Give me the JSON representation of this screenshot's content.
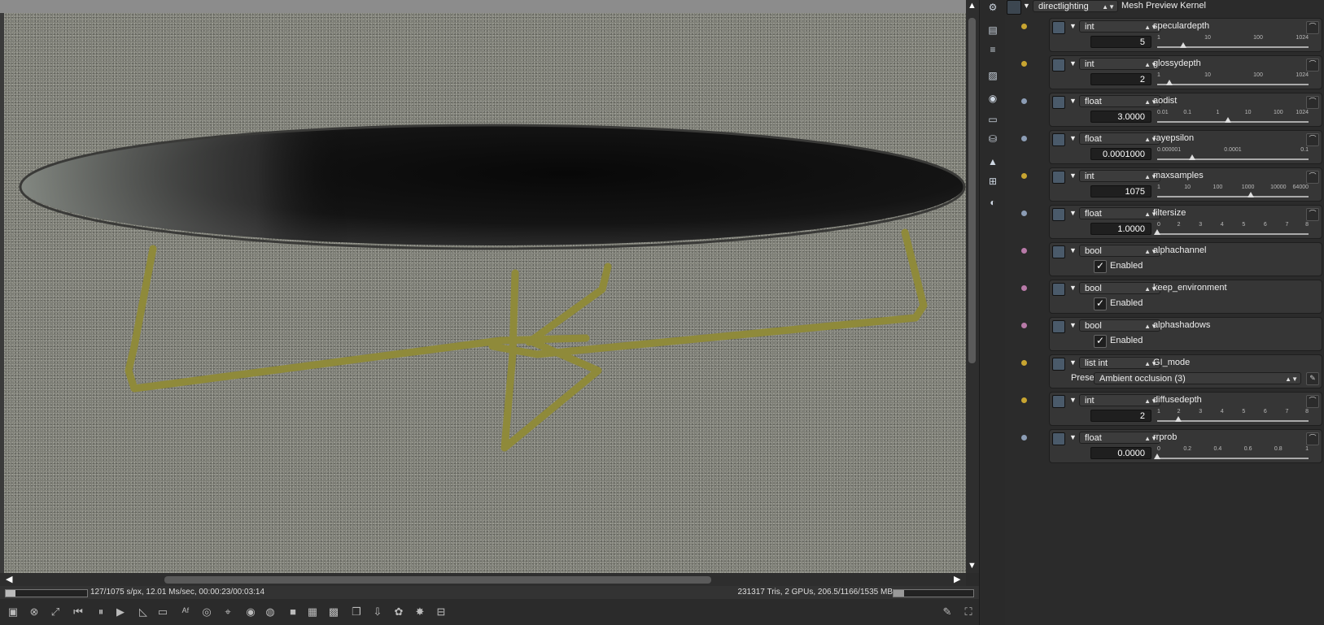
{
  "header": {
    "kernel_select": "directlighting",
    "title": "Mesh Preview Kernel"
  },
  "params": [
    {
      "name": "speculardepth",
      "type": "int",
      "kind": "slider",
      "icon": "int-icon",
      "dot": "#c8a531",
      "value": "5",
      "ticks": [
        "1",
        "10",
        "100",
        "1024"
      ],
      "thumb": 0.17
    },
    {
      "name": "glossydepth",
      "type": "int",
      "kind": "slider",
      "icon": "int-icon",
      "dot": "#c8a531",
      "value": "2",
      "ticks": [
        "1",
        "10",
        "100",
        "1024"
      ],
      "thumb": 0.08
    },
    {
      "name": "aodist",
      "type": "float",
      "kind": "slider",
      "icon": "float-icon",
      "dot": "#8c9db5",
      "value": "3.0000",
      "ticks": [
        "0.01",
        "0.1",
        "1",
        "10",
        "100",
        "1024"
      ],
      "thumb": 0.47
    },
    {
      "name": "rayepsilon",
      "type": "float",
      "kind": "slider",
      "icon": "float-icon",
      "dot": "#8c9db5",
      "value": "0.0001000",
      "ticks": [
        "0.000001",
        "0.0001",
        "0.1"
      ],
      "thumb": 0.23
    },
    {
      "name": "maxsamples",
      "type": "int",
      "kind": "slider",
      "icon": "int-icon",
      "dot": "#c8a531",
      "value": "1075",
      "ticks": [
        "1",
        "10",
        "100",
        "1000",
        "10000",
        "64000"
      ],
      "thumb": 0.62
    },
    {
      "name": "filtersize",
      "type": "float",
      "kind": "slider",
      "icon": "float-icon",
      "dot": "#8c9db5",
      "value": "1.0000",
      "ticks": [
        "0",
        "2",
        "3",
        "4",
        "5",
        "6",
        "7",
        "8"
      ],
      "thumb": 0.0
    },
    {
      "name": "alphachannel",
      "type": "bool",
      "kind": "bool",
      "icon": "bool-icon",
      "dot": "#b87aa8",
      "checked": "✓",
      "label": "Enabled"
    },
    {
      "name": "keep_environment",
      "type": "bool",
      "kind": "bool",
      "icon": "bool-icon",
      "dot": "#b87aa8",
      "checked": "✓",
      "label": "Enabled"
    },
    {
      "name": "alphashadows",
      "type": "bool",
      "kind": "bool",
      "icon": "bool-icon",
      "dot": "#b87aa8",
      "checked": "✓",
      "label": "Enabled"
    },
    {
      "name": "GI_mode",
      "type": "list int",
      "kind": "list",
      "icon": "int-icon",
      "dot": "#c8a531",
      "preset_label": "Preset",
      "preset": "Ambient occlusion (3)"
    },
    {
      "name": "diffusedepth",
      "type": "int",
      "kind": "slider",
      "icon": "int-icon",
      "dot": "#c8a531",
      "value": "2",
      "ticks": [
        "1",
        "2",
        "3",
        "4",
        "5",
        "6",
        "7",
        "8"
      ],
      "thumb": 0.14
    },
    {
      "name": "rrprob",
      "type": "float",
      "kind": "slider",
      "icon": "float-icon",
      "dot": "#8c9db5",
      "value": "0.0000",
      "ticks": [
        "0",
        "0.2",
        "0.4",
        "0.6",
        "0.8",
        "1"
      ],
      "thumb": 0.0
    }
  ],
  "status": {
    "left": "127/1075 s/px, 12.01 Ms/sec, 00:00:23/00:03:14",
    "right": "231317 Tris, 2 GPUs, 206.5/1166/1535 MB",
    "progress": 0.118,
    "memory": 0.13
  },
  "toolbar": {
    "items": [
      "render-icon",
      "stop-icon",
      "fit-icon",
      "rewind-icon",
      "pause-icon",
      "play-icon",
      "measure-icon",
      "display-icon",
      "af-icon",
      "focus-icon",
      "pick-icon",
      "material-pick-icon",
      "object-pick-icon",
      "region-icon",
      "film-region-icon",
      "checker-icon",
      "copy-icon",
      "save-icon",
      "world-icon",
      "lock-icon",
      "lock-icon-2"
    ],
    "right": [
      "wrench-icon",
      "fullscreen-icon"
    ]
  },
  "sidebar": [
    "render-settings-icon",
    "layers-icon",
    "list-icon",
    "image-icon",
    "camera-icon",
    "toggle-icon",
    "database-icon",
    "picture-icon",
    "node-icon",
    "paint-icon"
  ],
  "colors": {
    "accent": "#c8a531",
    "bg": "#2b2b2b",
    "panel": "#363636"
  }
}
